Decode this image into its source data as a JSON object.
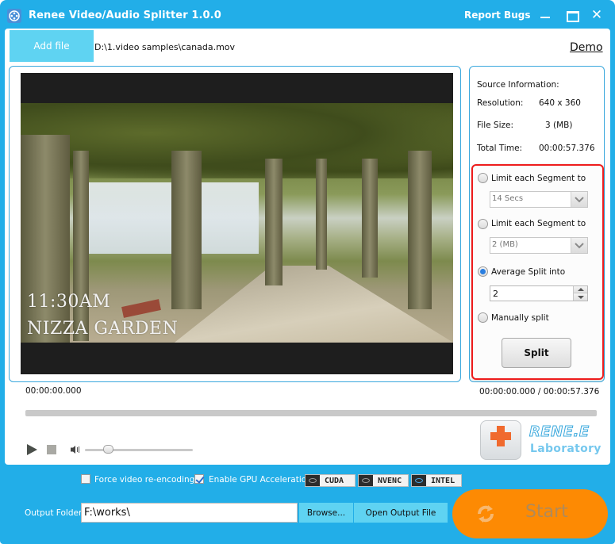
{
  "window": {
    "title": "Renee Video/Audio Splitter 1.0.0",
    "report_bugs": "Report Bugs",
    "accent_color": "#22aee8",
    "start_color": "#fd8a03"
  },
  "file": {
    "add_file_label": "Add file",
    "path": "D:\\1.video samples\\canada.mov",
    "demo_label": "Demo"
  },
  "video": {
    "overlay_line1": "11:30AM",
    "overlay_line2": "NIZZA GARDEN"
  },
  "source_info": {
    "heading": "Source Information:",
    "resolution_label": "Resolution:",
    "resolution_value": "640 x 360",
    "file_size_label": "File Size:",
    "file_size_value": "3 (MB)",
    "total_time_label": "Total Time:",
    "total_time_value": "00:00:57.376"
  },
  "split_options": {
    "limit_time_label": "Limit each Segment to",
    "limit_time_value": "14 Secs",
    "limit_size_label": "Limit each Segment to",
    "limit_size_value": "2 (MB)",
    "average_label": "Average Split into",
    "average_value": "2",
    "manual_label": "Manually split",
    "selected": "average",
    "split_button": "Split"
  },
  "playback": {
    "current_time": "00:00:00.000",
    "time_readout": "00:00:00.000 / 00:00:57.376",
    "progress": 0,
    "volume": 0.2
  },
  "logo": {
    "brand": "RENE.E",
    "sub": "Laboratory"
  },
  "options": {
    "force_reencode_label": "Force video re-encoding",
    "force_reencode_checked": false,
    "gpu_label": "Enable GPU Acceleration",
    "gpu_checked": true,
    "gpu_badges": [
      "CUDA",
      "NVENC",
      "INTEL"
    ]
  },
  "output": {
    "label": "Output Folder:",
    "path": "F:\\works\\",
    "browse_label": "Browse...",
    "open_label": "Open Output File",
    "start_label": "Start"
  }
}
